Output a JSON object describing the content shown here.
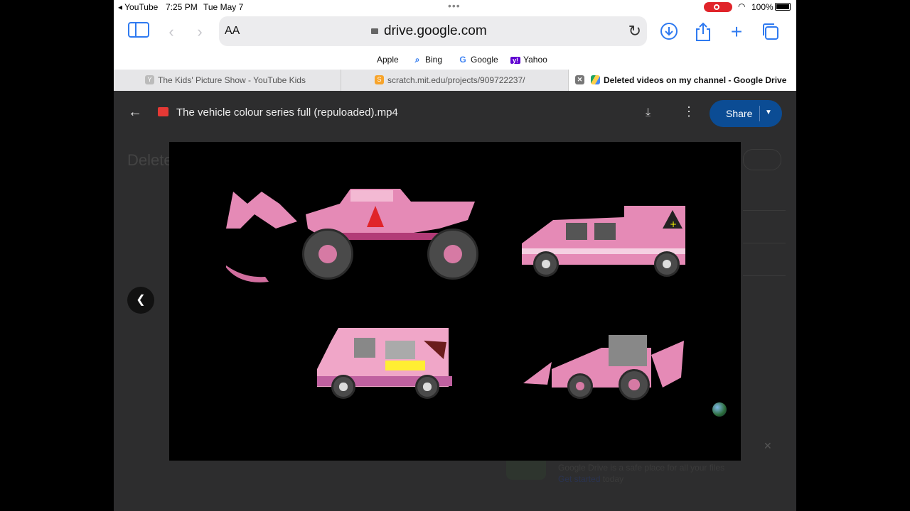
{
  "status_bar": {
    "back_app": "◂ YouTube",
    "time": "7:25 PM",
    "date": "Tue May 7",
    "battery": "100%"
  },
  "toolbar": {
    "text_size": "AA",
    "url": "drive.google.com"
  },
  "favorites": [
    {
      "label": "Apple",
      "icon": "apple-icon"
    },
    {
      "label": "Bing",
      "icon": "bing-search-icon"
    },
    {
      "label": "Google",
      "icon": "google-icon"
    },
    {
      "label": "Yahoo",
      "icon": "yahoo-icon"
    }
  ],
  "tabs": [
    {
      "label": "The Kids' Picture Show - YouTube Kids",
      "active": false
    },
    {
      "label": "scratch.mit.edu/projects/909722237/",
      "active": false
    },
    {
      "label": "Deleted videos on my channel - Google Drive",
      "active": true
    }
  ],
  "drive": {
    "file_title": "The vehicle colour series full (repuloaded).mp4",
    "share_label": "Share",
    "ghost_title": "Delete",
    "promo_line1": "Google Drive is a safe place for all your files",
    "promo_link": "Get started",
    "promo_link_suffix": " today"
  },
  "colors": {
    "accent": "#2f7af0",
    "share": "#0b4c94",
    "vehicle_pink": "#e58ab6"
  }
}
